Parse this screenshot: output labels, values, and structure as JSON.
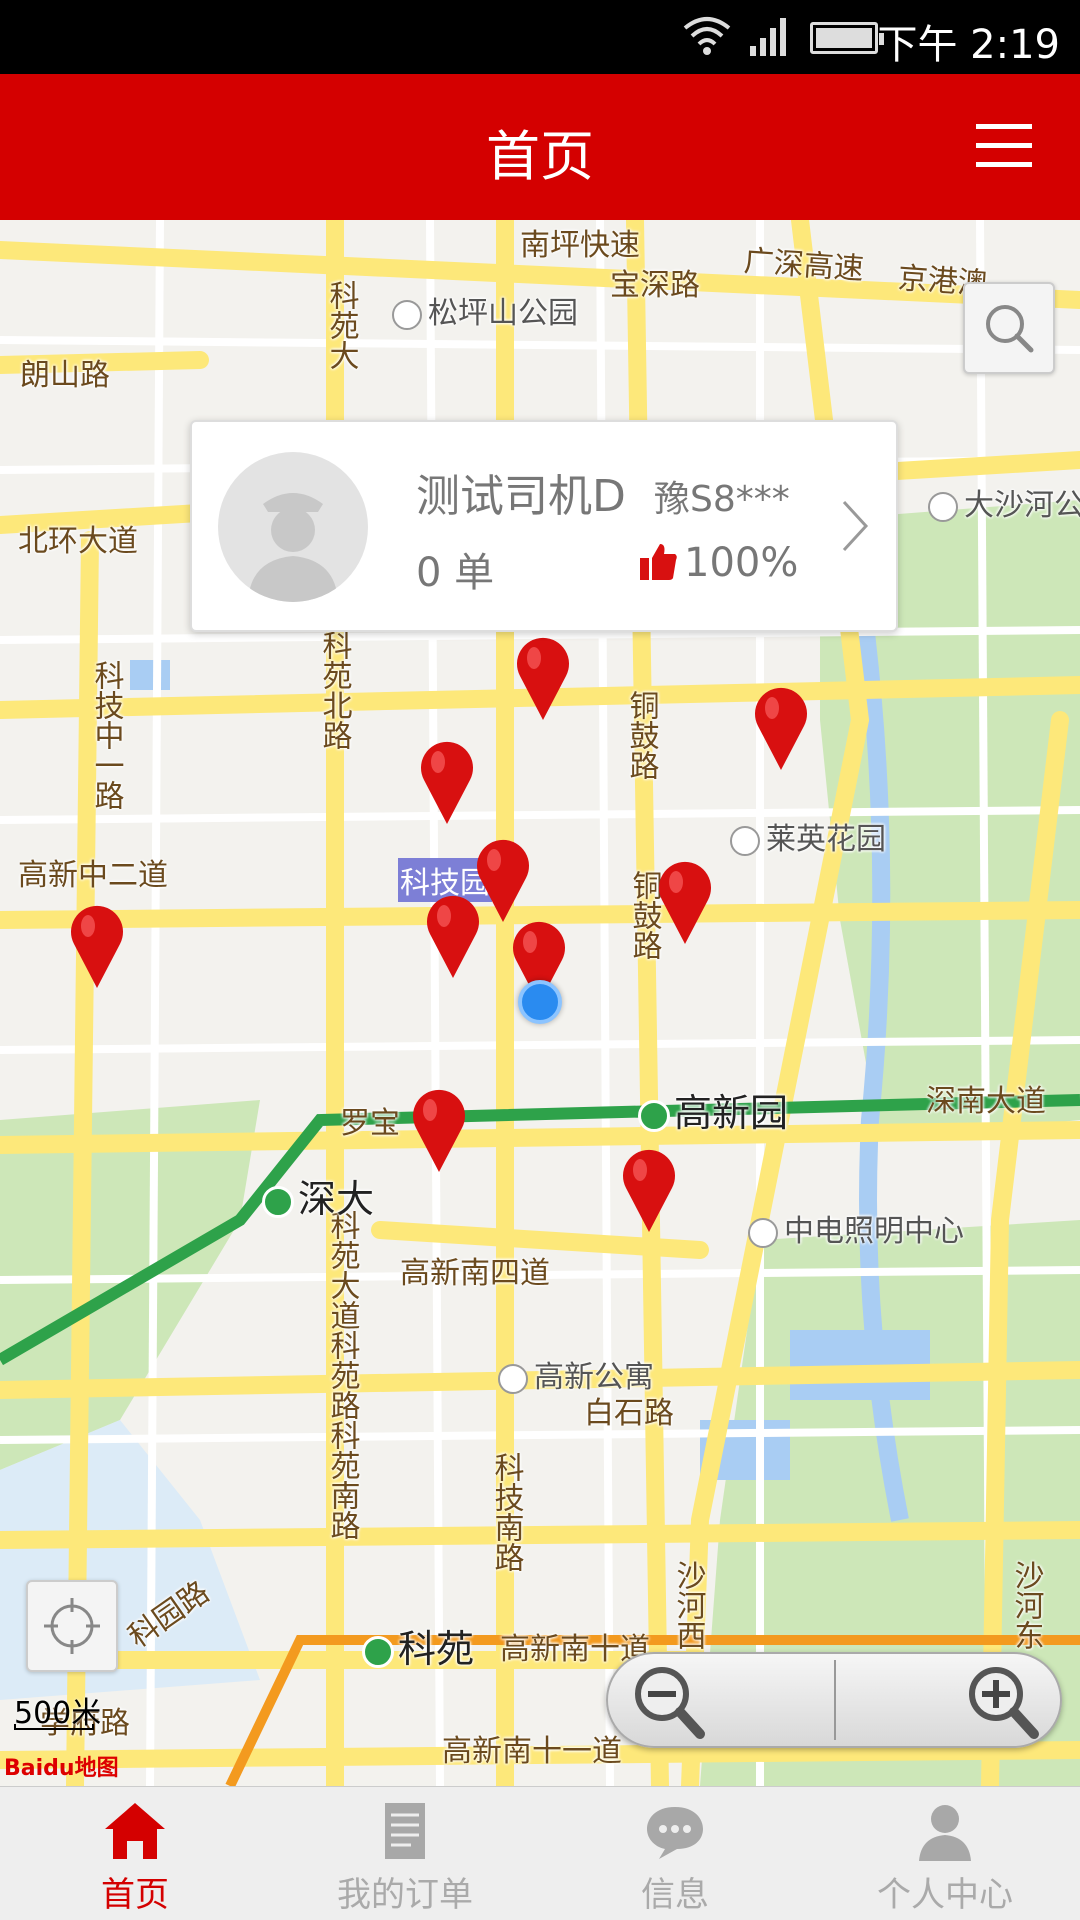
{
  "status_bar": {
    "time": "下午 2:19"
  },
  "header": {
    "title": "首页"
  },
  "map": {
    "road_labels": {
      "nanping": "南坪快速",
      "baoshen": "宝深路",
      "guangshen": "广深高速",
      "jinggang": "京港澳",
      "langshan": "朗山路",
      "beihuan": "北环大道",
      "keyuan_top": "科苑大",
      "keyuan_north": "科苑北路",
      "keji_zhong": "科技中一路",
      "gaoxin_zhong2": "高新中二道",
      "tonggu": "铜鼓路",
      "tonggu2": "铜鼓路",
      "keji_highlight": "科技园",
      "luobao": "罗宝",
      "shennan": "深南大道",
      "gaoxin_nan4": "高新南四道",
      "keyuan_south": "科苑大道科苑路科苑南路",
      "baishi": "白石路",
      "keji_nan": "科技南路",
      "keyuan_road": "科园路",
      "xuefu": "学府路",
      "gaoxin_nan10": "高新南十道",
      "gaoxin_nan11": "高新南十一道",
      "shahe": "沙河西",
      "shahe_dong": "沙河东"
    },
    "pois": {
      "songpingshan": "松坪山公园",
      "dashahe": "大沙河公",
      "laiying": "莱英花园",
      "zhongdian": "中电照明中心",
      "gaoxin_apt": "高新公寓"
    },
    "stations": {
      "gaoxinyuan": "高新园",
      "shenda": "深大",
      "keyuan": "科苑"
    },
    "scale": "500米",
    "logo": "Baidu地图"
  },
  "driver_card": {
    "name": "测试司机D",
    "plate": "豫S8***",
    "orders": "0 单",
    "rating": "100%"
  },
  "tabs": [
    {
      "label": "首页",
      "icon": "home-icon"
    },
    {
      "label": "我的订单",
      "icon": "orders-icon"
    },
    {
      "label": "信息",
      "icon": "message-icon"
    },
    {
      "label": "个人中心",
      "icon": "person-icon"
    }
  ],
  "colors": {
    "brand": "#d40000",
    "road": "#fde87a",
    "metro": "#2ea24a",
    "park": "#cde7b8",
    "water": "#a9cdf3"
  }
}
